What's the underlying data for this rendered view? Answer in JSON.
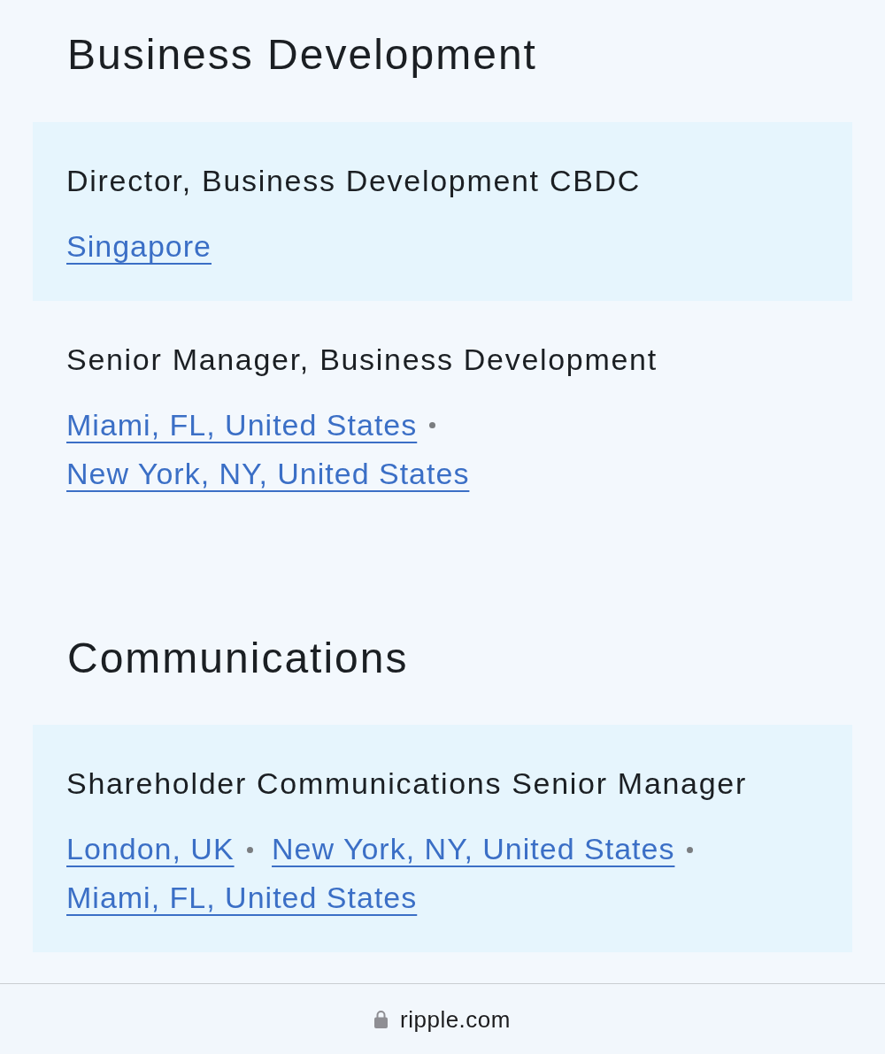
{
  "sections": [
    {
      "heading": "Business Development",
      "jobs": [
        {
          "title": "Director, Business Development CBDC",
          "locations": [
            "Singapore"
          ]
        },
        {
          "title": "Senior Manager, Business Development",
          "locations": [
            "Miami, FL, United States",
            "New York, NY, United States"
          ]
        }
      ]
    },
    {
      "heading": "Communications",
      "jobs": [
        {
          "title": "Shareholder Communications Senior Manager",
          "locations": [
            "London, UK",
            "New York, NY, United States",
            "Miami, FL, United States"
          ]
        }
      ]
    }
  ],
  "address_bar": {
    "url": "ripple.com"
  }
}
